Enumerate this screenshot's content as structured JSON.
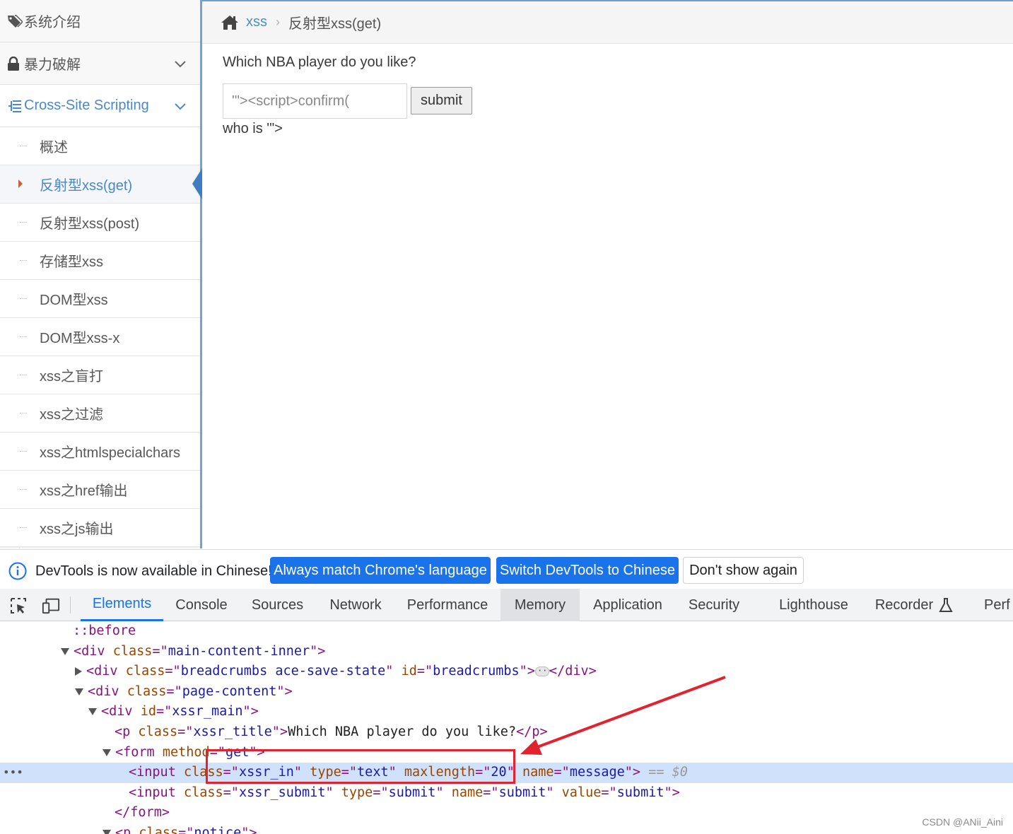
{
  "sidebar": {
    "top_items": [
      {
        "label": "系统介绍",
        "icon": "tags-icon"
      },
      {
        "label": "暴力破解",
        "icon": "lock-icon"
      },
      {
        "label": "Cross-Site Scripting",
        "icon": "list-tree-icon"
      }
    ],
    "sub_items": [
      {
        "label": "概述"
      },
      {
        "label": "反射型xss(get)",
        "active": true
      },
      {
        "label": "反射型xss(post)"
      },
      {
        "label": "存储型xss"
      },
      {
        "label": "DOM型xss"
      },
      {
        "label": "DOM型xss-x"
      },
      {
        "label": "xss之盲打"
      },
      {
        "label": "xss之过滤"
      },
      {
        "label": "xss之htmlspecialchars"
      },
      {
        "label": "xss之href输出"
      },
      {
        "label": "xss之js输出"
      }
    ]
  },
  "breadcrumbs": {
    "home_icon": "home-icon",
    "link": "xss",
    "current": "反射型xss(get)"
  },
  "main": {
    "title": "Which NBA player do you like?",
    "input_value": "'\"><script>confirm(",
    "submit_label": "submit",
    "result": "who is '\">"
  },
  "devtools": {
    "infobar": {
      "text": "DevTools is now available in Chinese!",
      "btn_match": "Always match Chrome's language",
      "btn_switch": "Switch DevTools to Chinese",
      "btn_dismiss": "Don't show again"
    },
    "tabs": [
      "Elements",
      "Console",
      "Sources",
      "Network",
      "Performance",
      "Memory",
      "Application",
      "Security",
      "Lighthouse",
      "Recorder",
      "Perf"
    ],
    "active_tab": "Elements",
    "dom": {
      "before": "::before",
      "main_content_inner": "main-content-inner",
      "breadcrumbs_class": "breadcrumbs ace-save-state",
      "breadcrumbs_id": "breadcrumbs",
      "page_content": "page-content",
      "xssr_main": "xssr_main",
      "xssr_title": "xssr_title",
      "p_text": "Which NBA player do you like?",
      "form_method": "get",
      "input_class": "xssr_in",
      "input_type": "text",
      "input_maxlength": "20",
      "input_name": "message",
      "dollar0": "== $0",
      "submit_class": "xssr_submit",
      "submit_type": "submit",
      "submit_name": "submit",
      "submit_value": "submit",
      "notice_class": "notice"
    }
  },
  "watermark": "CSDN @ANii_Aini",
  "colors": {
    "accent": "#4b88c9",
    "devtools_blue": "#1a73e8",
    "annotation_red": "#e0232e"
  }
}
